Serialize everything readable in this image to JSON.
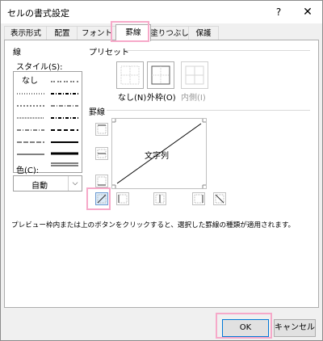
{
  "window": {
    "title": "セルの書式設定",
    "help_label": "?",
    "close_label": "✕"
  },
  "tabs": [
    {
      "label": "表示形式"
    },
    {
      "label": "配置"
    },
    {
      "label": "フォント"
    },
    {
      "label": "罫線",
      "active": true
    },
    {
      "label": "塗りつぶし"
    },
    {
      "label": "保護"
    }
  ],
  "line_group": {
    "title": "線",
    "style_label": "スタイル(S):",
    "none_label": "なし",
    "color_label": "色(C):",
    "color_value": "自動"
  },
  "preset_group": {
    "title": "プリセット",
    "none_label": "なし(N)",
    "outline_label": "外枠(O)",
    "inside_label": "内側(I)"
  },
  "border_group": {
    "title": "罫線",
    "preview_text": "文字列"
  },
  "footer_note": "プレビュー枠内または上のボタンをクリックすると、選択した罫線の種類が適用されます。",
  "buttons": {
    "ok": "OK",
    "cancel": "キャンセル"
  },
  "colors": {
    "highlight": "#f6a9c9",
    "accent": "#0078d7"
  }
}
